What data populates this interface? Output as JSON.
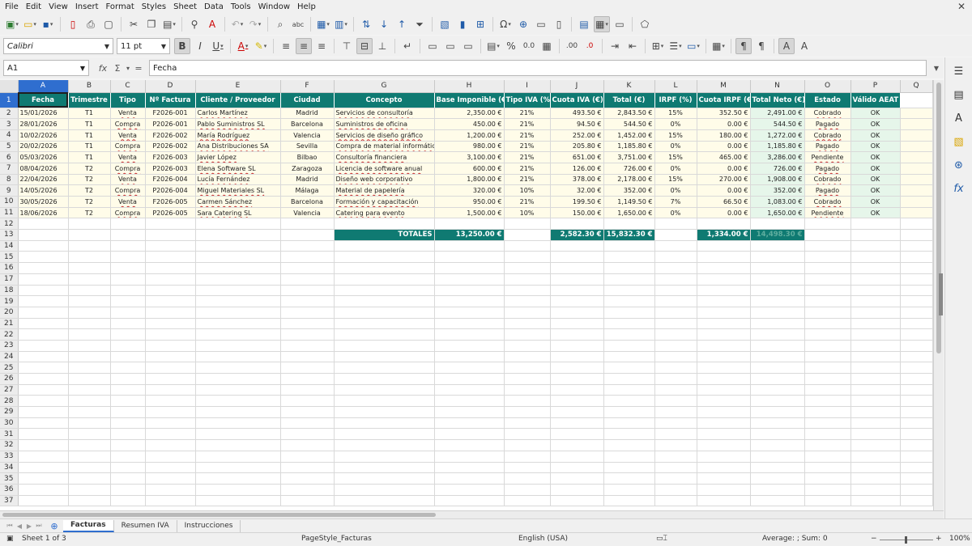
{
  "menu": [
    "File",
    "Edit",
    "View",
    "Insert",
    "Format",
    "Styles",
    "Sheet",
    "Data",
    "Tools",
    "Window",
    "Help"
  ],
  "font": {
    "name": "Calibri",
    "size": "11 pt"
  },
  "formula": {
    "cell_ref": "A1",
    "content": "Fecha"
  },
  "columns": [
    "A",
    "B",
    "C",
    "D",
    "E",
    "F",
    "G",
    "H",
    "I",
    "J",
    "K",
    "L",
    "M",
    "N",
    "O",
    "P",
    "Q"
  ],
  "headers": [
    "Fecha",
    "Trimestre",
    "Tipo",
    "Nº Factura",
    "Cliente / Proveedor",
    "Ciudad",
    "Concepto",
    "Base Imponible (€)",
    "Tipo IVA (%)",
    "Cuota IVA (€)",
    "Total (€)",
    "IRPF (%)",
    "Cuota IRPF (€)",
    "Total Neto (€)",
    "Estado",
    "Válido AEAT"
  ],
  "rows": [
    [
      "15/01/2026",
      "T1",
      "Venta",
      "F2026-001",
      "Carlos Martínez",
      "Madrid",
      "Servicios de consultoría",
      "2,350.00 €",
      "21%",
      "493.50 €",
      "2,843.50 €",
      "15%",
      "352.50 €",
      "2,491.00 €",
      "Cobrado",
      "OK"
    ],
    [
      "28/01/2026",
      "T1",
      "Compra",
      "P2026-001",
      "Pablo Suministros SL",
      "Barcelona",
      "Suministros de oficina",
      "450.00 €",
      "21%",
      "94.50 €",
      "544.50 €",
      "0%",
      "0.00 €",
      "544.50 €",
      "Pagado",
      "OK"
    ],
    [
      "10/02/2026",
      "T1",
      "Venta",
      "F2026-002",
      "María Rodríguez",
      "Valencia",
      "Servicios de diseño gráfico",
      "1,200.00 €",
      "21%",
      "252.00 €",
      "1,452.00 €",
      "15%",
      "180.00 €",
      "1,272.00 €",
      "Cobrado",
      "OK"
    ],
    [
      "20/02/2026",
      "T1",
      "Compra",
      "P2026-002",
      "Ana Distribuciones SA",
      "Sevilla",
      "Compra de material informático",
      "980.00 €",
      "21%",
      "205.80 €",
      "1,185.80 €",
      "0%",
      "0.00 €",
      "1,185.80 €",
      "Pagado",
      "OK"
    ],
    [
      "05/03/2026",
      "T1",
      "Venta",
      "F2026-003",
      "Javier López",
      "Bilbao",
      "Consultoría financiera",
      "3,100.00 €",
      "21%",
      "651.00 €",
      "3,751.00 €",
      "15%",
      "465.00 €",
      "3,286.00 €",
      "Pendiente",
      "OK"
    ],
    [
      "08/04/2026",
      "T2",
      "Compra",
      "P2026-003",
      "Elena Software SL",
      "Zaragoza",
      "Licencia de software anual",
      "600.00 €",
      "21%",
      "126.00 €",
      "726.00 €",
      "0%",
      "0.00 €",
      "726.00 €",
      "Pagado",
      "OK"
    ],
    [
      "22/04/2026",
      "T2",
      "Venta",
      "F2026-004",
      "Lucía Fernández",
      "Madrid",
      "Diseño web corporativo",
      "1,800.00 €",
      "21%",
      "378.00 €",
      "2,178.00 €",
      "15%",
      "270.00 €",
      "1,908.00 €",
      "Cobrado",
      "OK"
    ],
    [
      "14/05/2026",
      "T2",
      "Compra",
      "P2026-004",
      "Miguel Materiales SL",
      "Málaga",
      "Material de papelería",
      "320.00 €",
      "10%",
      "32.00 €",
      "352.00 €",
      "0%",
      "0.00 €",
      "352.00 €",
      "Pagado",
      "OK"
    ],
    [
      "30/05/2026",
      "T2",
      "Venta",
      "F2026-005",
      "Carmen Sánchez",
      "Barcelona",
      "Formación y capacitación",
      "950.00 €",
      "21%",
      "199.50 €",
      "1,149.50 €",
      "7%",
      "66.50 €",
      "1,083.00 €",
      "Cobrado",
      "OK"
    ],
    [
      "18/06/2026",
      "T2",
      "Compra",
      "P2026-005",
      "Sara Catering SL",
      "Valencia",
      "Catering para evento",
      "1,500.00 €",
      "10%",
      "150.00 €",
      "1,650.00 €",
      "0%",
      "0.00 €",
      "1,650.00 €",
      "Pendiente",
      "OK"
    ]
  ],
  "totals": {
    "label": "TOTALES",
    "base": "13,250.00 €",
    "iva": "2,582.30 €",
    "total": "15,832.30 €",
    "irpf": "1,334.00 €",
    "neto": "14,498.30 €"
  },
  "tabs": [
    "Facturas",
    "Resumen IVA",
    "Instrucciones"
  ],
  "active_tab": "Facturas",
  "status": {
    "sheet": "Sheet 1 of 3",
    "page_style": "PageStyle_Facturas",
    "language": "English (USA)",
    "selection": "Average: ; Sum: 0",
    "zoom": "100%"
  },
  "colors": {
    "header_bg": "#0f7a72",
    "data_bg": "#fffce9",
    "highlight_bg": "#e6f6ea",
    "selection": "#2f6ecf"
  }
}
